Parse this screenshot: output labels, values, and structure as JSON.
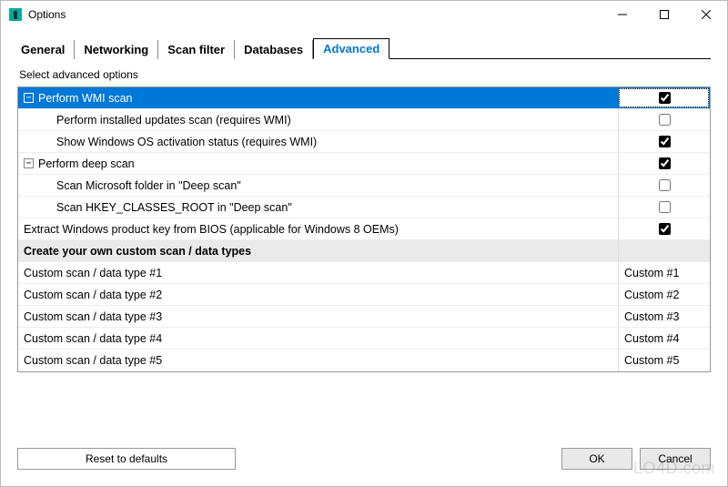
{
  "window": {
    "title": "Options"
  },
  "tabs": {
    "general": "General",
    "networking": "Networking",
    "scan_filter": "Scan filter",
    "databases": "Databases",
    "advanced": "Advanced"
  },
  "subhead": "Select advanced options",
  "section_bios": "Extract Windows product key from BIOS (applicable for Windows 8 OEMs)",
  "header_custom": "Create your own custom scan / data types",
  "tree": {
    "wmi": {
      "label": "Perform WMI scan",
      "expander": "−",
      "checked": true,
      "children": {
        "updates": {
          "label": "Perform installed updates scan (requires WMI)",
          "checked": false
        },
        "activation": {
          "label": "Show Windows OS activation status (requires WMI)",
          "checked": true
        }
      }
    },
    "deep": {
      "label": "Perform deep scan",
      "expander": "−",
      "checked": true,
      "children": {
        "msfolder": {
          "label": "Scan Microsoft folder in \"Deep scan\"",
          "checked": false
        },
        "hkcr": {
          "label": "Scan HKEY_CLASSES_ROOT in \"Deep scan\"",
          "checked": false
        }
      }
    },
    "bios": {
      "checked": true
    }
  },
  "custom_rows": [
    {
      "label": "Custom scan / data type #1",
      "value": "Custom #1"
    },
    {
      "label": "Custom scan / data type #2",
      "value": "Custom #2"
    },
    {
      "label": "Custom scan / data type #3",
      "value": "Custom #3"
    },
    {
      "label": "Custom scan / data type #4",
      "value": "Custom #4"
    },
    {
      "label": "Custom scan / data type #5",
      "value": "Custom #5"
    }
  ],
  "buttons": {
    "reset": "Reset to defaults",
    "ok": "OK",
    "cancel": "Cancel"
  },
  "watermark": "LO4D.com"
}
